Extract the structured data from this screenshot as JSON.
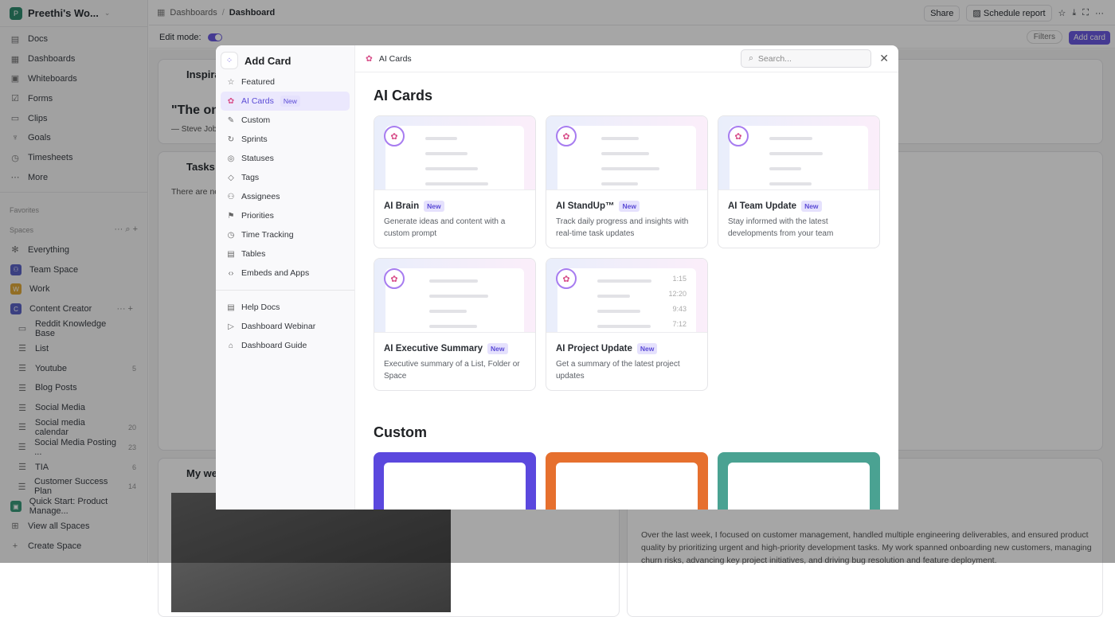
{
  "workspace": {
    "name": "Preethi's Wo...",
    "initial": "P"
  },
  "sidebar": {
    "items": [
      {
        "label": "Docs",
        "icon": "doc-icon"
      },
      {
        "label": "Dashboards",
        "icon": "dashboard-icon"
      },
      {
        "label": "Whiteboards",
        "icon": "whiteboard-icon"
      },
      {
        "label": "Forms",
        "icon": "form-icon"
      },
      {
        "label": "Clips",
        "icon": "clip-icon"
      },
      {
        "label": "Goals",
        "icon": "trophy-icon"
      },
      {
        "label": "Timesheets",
        "icon": "timesheet-icon"
      },
      {
        "label": "More",
        "icon": "more-icon"
      }
    ],
    "favorites": "Favorites",
    "spaces_label": "Spaces",
    "spaces": [
      {
        "label": "Everything"
      },
      {
        "label": "Team Space"
      },
      {
        "label": "Work",
        "initial": "W"
      },
      {
        "label": "Content Creator",
        "initial": "C"
      }
    ],
    "lists": [
      {
        "label": "Reddit Knowledge Base",
        "count": ""
      },
      {
        "label": "List",
        "count": ""
      },
      {
        "label": "Youtube",
        "count": "5"
      },
      {
        "label": "Blog Posts",
        "count": ""
      },
      {
        "label": "Social Media",
        "count": ""
      },
      {
        "label": "Social media calendar",
        "count": "20"
      },
      {
        "label": "Social Media Posting ...",
        "count": "23"
      },
      {
        "label": "TIA",
        "count": "6"
      },
      {
        "label": "Customer Success Plan",
        "count": "14"
      }
    ],
    "quick_start": "Quick Start: Product Manage...",
    "view_all": "View all Spaces",
    "create": "Create Space"
  },
  "header": {
    "crumb1": "Dashboards",
    "sep": "/",
    "crumb2": "Dashboard",
    "share": "Share",
    "schedule": "Schedule report",
    "edit_mode": "Edit mode:",
    "filters": "Filters",
    "add_card": "Add card"
  },
  "background": {
    "card1_title": "Inspira",
    "quote": "\"The onl",
    "author": "— Steve Job",
    "card2_title": "Tasks I",
    "empty": "There are no",
    "card3_title": "My wee",
    "summary": "Over the last week, I focused on customer management, handled multiple engineering deliverables, and ensured product quality by prioritizing urgent and high-priority development tasks. My work spanned onboarding new customers, managing churn risks, advancing key project initiatives, and driving bug resolution and feature deployment."
  },
  "modal": {
    "title": "Add Card",
    "header_label": "AI Cards",
    "search_placeholder": "Search...",
    "new_badge": "New",
    "nav": [
      {
        "label": "Featured",
        "icon": "☆"
      },
      {
        "label": "AI Cards",
        "icon": "✿",
        "active": true
      },
      {
        "label": "Custom",
        "icon": "✎"
      },
      {
        "label": "Sprints",
        "icon": "↻"
      },
      {
        "label": "Statuses",
        "icon": "◎"
      },
      {
        "label": "Tags",
        "icon": "◇"
      },
      {
        "label": "Assignees",
        "icon": "⚇"
      },
      {
        "label": "Priorities",
        "icon": "⚑"
      },
      {
        "label": "Time Tracking",
        "icon": "◷"
      },
      {
        "label": "Tables",
        "icon": "▤"
      },
      {
        "label": "Embeds and Apps",
        "icon": "‹›"
      }
    ],
    "help": [
      {
        "label": "Help Docs"
      },
      {
        "label": "Dashboard Webinar"
      },
      {
        "label": "Dashboard Guide"
      }
    ],
    "section_ai": "AI Cards",
    "section_custom": "Custom",
    "cards": [
      {
        "title": "AI Brain",
        "desc": "Generate ideas and content with a custom prompt"
      },
      {
        "title": "AI StandUp™",
        "desc": "Track daily progress and insights with real-time task updates"
      },
      {
        "title": "AI Team Update",
        "desc": "Stay informed with the latest developments from your team"
      },
      {
        "title": "AI Executive Summary",
        "desc": "Executive summary of a List, Folder or Space"
      },
      {
        "title": "AI Project Update",
        "desc": "Get a summary of the latest project updates",
        "times": [
          "1:15",
          "12:20",
          "9:43",
          "7:12"
        ]
      }
    ],
    "custom_colors": [
      "#5b48de",
      "#e6702e",
      "#4aa292"
    ]
  }
}
